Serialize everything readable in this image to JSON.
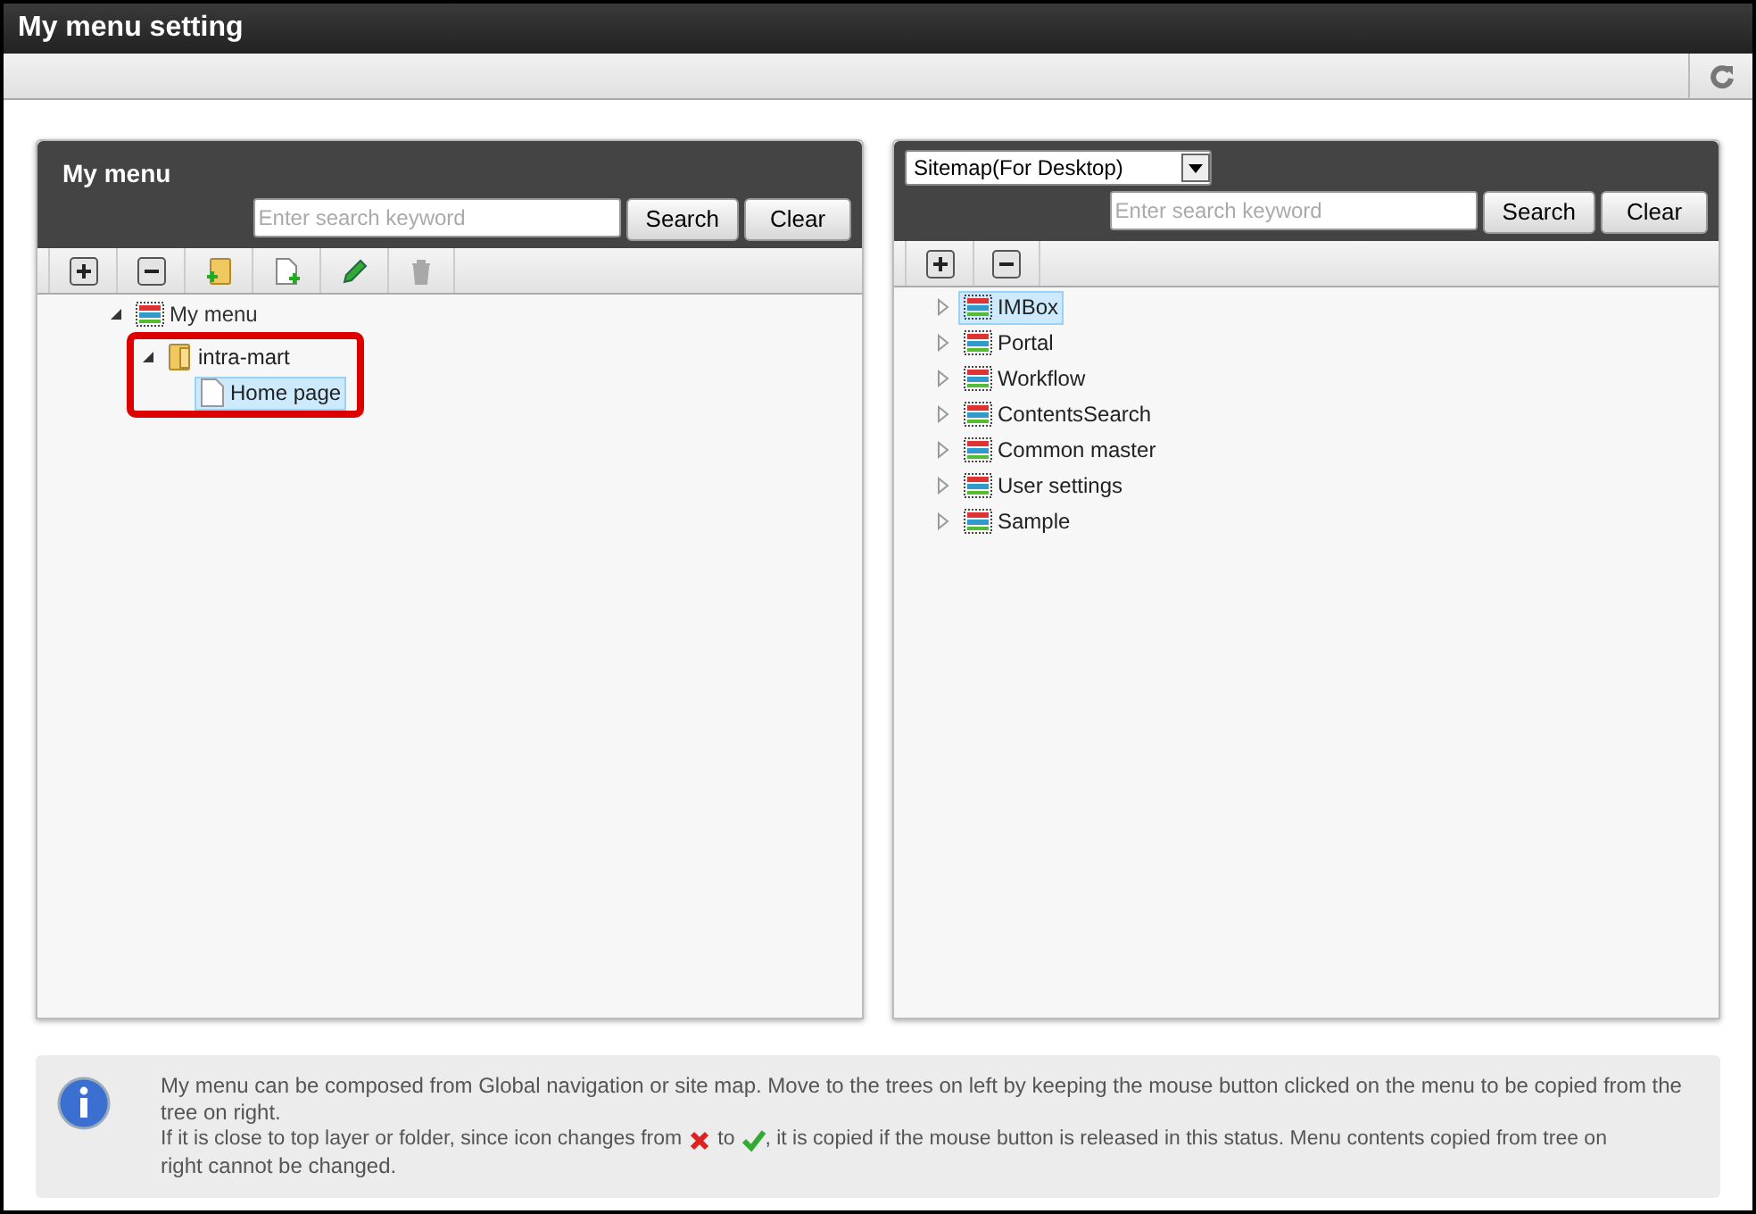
{
  "window": {
    "title": "My menu setting"
  },
  "left_panel": {
    "title": "My menu",
    "search": {
      "placeholder": "Enter search keyword"
    },
    "buttons": [
      "Search",
      "Clear"
    ],
    "tools": [
      {
        "kind": "expand",
        "disabled": false
      },
      {
        "kind": "collapse",
        "disabled": false
      },
      {
        "kind": "add-folder",
        "disabled": false
      },
      {
        "kind": "add-page",
        "disabled": false
      },
      {
        "kind": "edit",
        "disabled": false
      },
      {
        "kind": "delete",
        "disabled": true
      }
    ],
    "tree": [
      {
        "label": "My menu",
        "kind": "menu",
        "expanded": true,
        "selected": false,
        "highlighted": false,
        "children": [
          {
            "label": "intra-mart",
            "kind": "folder",
            "expanded": true,
            "selected": false,
            "highlighted": true,
            "children": [
              {
                "label": "Home page",
                "kind": "page",
                "selected": true,
                "highlighted": false
              }
            ]
          }
        ]
      }
    ]
  },
  "right_panel": {
    "dropdown": {
      "value": "Sitemap(For Desktop)"
    },
    "search": {
      "placeholder": "Enter search keyword"
    },
    "buttons": [
      "Search",
      "Clear"
    ],
    "tools": [
      {
        "kind": "expand",
        "disabled": false
      },
      {
        "kind": "collapse",
        "disabled": false
      }
    ],
    "tree": [
      {
        "label": "IMBox",
        "kind": "menu",
        "expanded": false,
        "selected": true
      },
      {
        "label": "Portal",
        "kind": "menu",
        "expanded": false,
        "selected": false
      },
      {
        "label": "Workflow",
        "kind": "menu",
        "expanded": false,
        "selected": false
      },
      {
        "label": "ContentsSearch",
        "kind": "menu",
        "expanded": false,
        "selected": false
      },
      {
        "label": "Common master",
        "kind": "menu",
        "expanded": false,
        "selected": false
      },
      {
        "label": "User settings",
        "kind": "menu",
        "expanded": false,
        "selected": false
      },
      {
        "label": "Sample",
        "kind": "menu",
        "expanded": false,
        "selected": false
      }
    ]
  },
  "info": {
    "line_1": "My menu can be composed from Global navigation or site map. Move to the trees on left by keeping the mouse button clicked on the menu to be copied from the tree on right.",
    "line_2_before": "If it is close to top layer or folder, since icon changes from",
    "line_2_middle": "to",
    "line_2_after": ", it is copied if the mouse button is released in this status. Menu contents copied from tree on",
    "line_3": "right cannot be changed."
  }
}
